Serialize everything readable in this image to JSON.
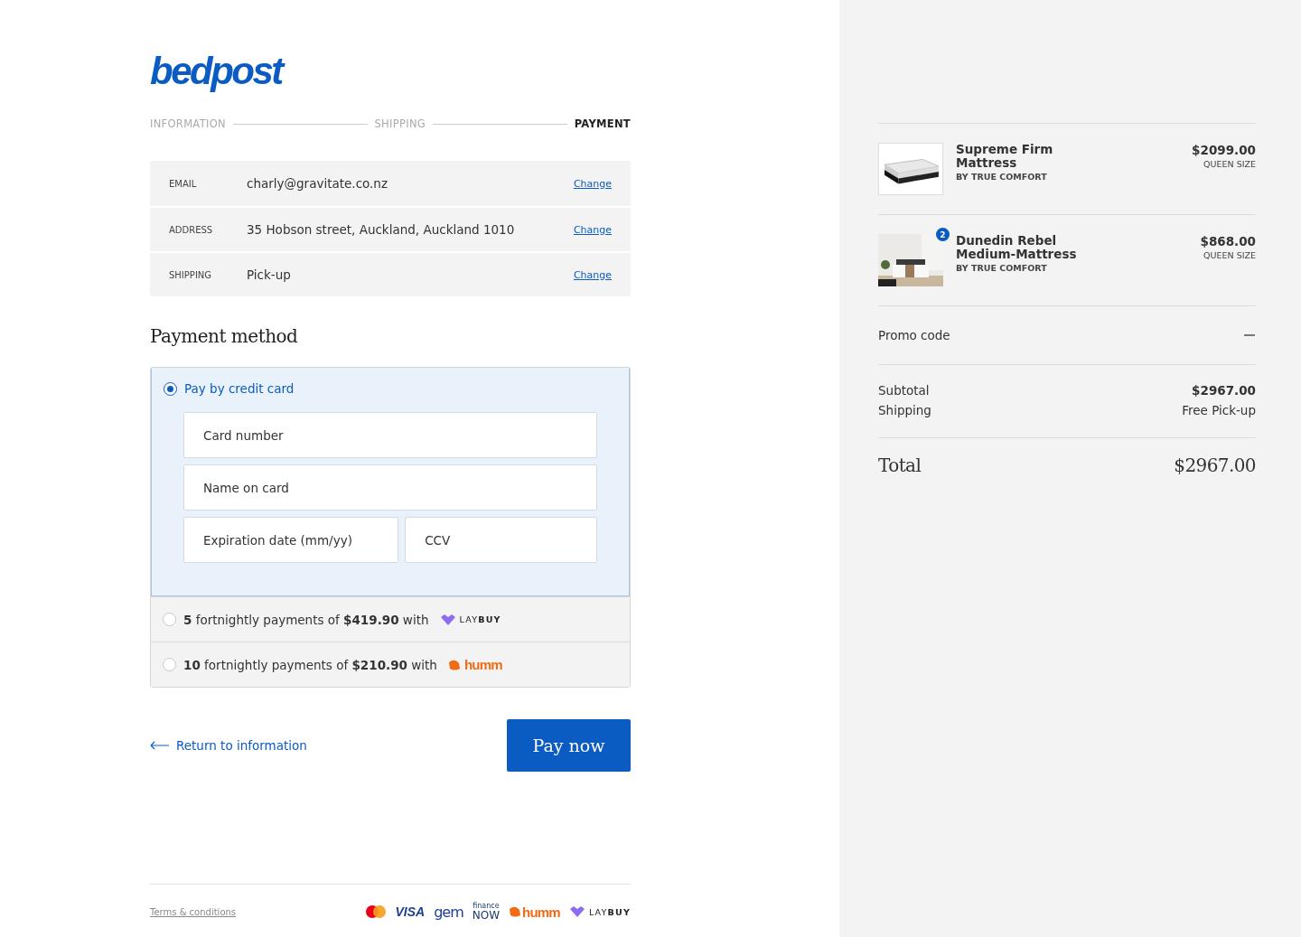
{
  "logo": "bedpost",
  "steps": [
    {
      "label": "INFORMATION",
      "selected": false
    },
    {
      "label": "SHIPPING",
      "selected": false
    },
    {
      "label": "PAYMENT",
      "selected": true
    }
  ],
  "review": [
    {
      "label": "EMAIL",
      "value": "charly@gravitate.co.nz",
      "action": "Change"
    },
    {
      "label": "ADDRESS",
      "value": "35 Hobson street, Auckland, Auckland 1010",
      "action": "Change"
    },
    {
      "label": "SHIPPING",
      "value": "Pick-up",
      "action": "Change"
    }
  ],
  "payment_method": {
    "title": "Payment method",
    "options": [
      {
        "kind": "card",
        "label": "Pay by credit card",
        "selected": true,
        "fields": [
          [
            {
              "placeholder": "Card number"
            }
          ],
          [
            {
              "placeholder": "Name on card"
            }
          ],
          [
            {
              "placeholder": "Expiration date (mm/yy)"
            },
            {
              "placeholder": "CCV"
            }
          ]
        ]
      },
      {
        "kind": "laybuy",
        "label": "**5** fortnightly payments of **$419.90** with",
        "brand": [
          "LAY",
          "BUY"
        ],
        "selected": false
      },
      {
        "kind": "humm",
        "label": "**10** fortnightly payments of **$210.90** with",
        "brand": [
          "humm"
        ],
        "selected": false
      }
    ]
  },
  "back_link": "Return to information",
  "pay_button": "Pay now",
  "footer": {
    "link": "Terms & conditions",
    "logos": [
      {
        "kind": "mastercard"
      },
      {
        "kind": "visa",
        "text": "VISA"
      },
      {
        "kind": "gem",
        "text": "gem"
      },
      {
        "kind": "financenow",
        "text": "finance",
        "text2": "NOW"
      },
      {
        "kind": "humm",
        "text": "humm"
      },
      {
        "kind": "laybuy",
        "text": "LAY",
        "text2": "BUY"
      }
    ]
  },
  "cart": {
    "items": [
      {
        "name": "Supreme Firm Mattress",
        "brand": "BY TRUE COMFORT",
        "price": "$2099.00",
        "size": "QUEEN SIZE"
      },
      {
        "name": "Dunedin Rebel Medium-Mattress",
        "brand": "BY TRUE COMFORT",
        "price": "$868.00",
        "size": "QUEEN SIZE",
        "quantity": "2"
      }
    ],
    "promo": {
      "label": "Promo code",
      "expanded": true
    },
    "lines": [
      {
        "label": "Subtotal",
        "value": "$2967.00",
        "bold": true
      },
      {
        "label": "Shipping",
        "value": "Free Pick-up",
        "bold": false
      }
    ],
    "total": {
      "label": "Total",
      "value": "$2967.00"
    }
  }
}
